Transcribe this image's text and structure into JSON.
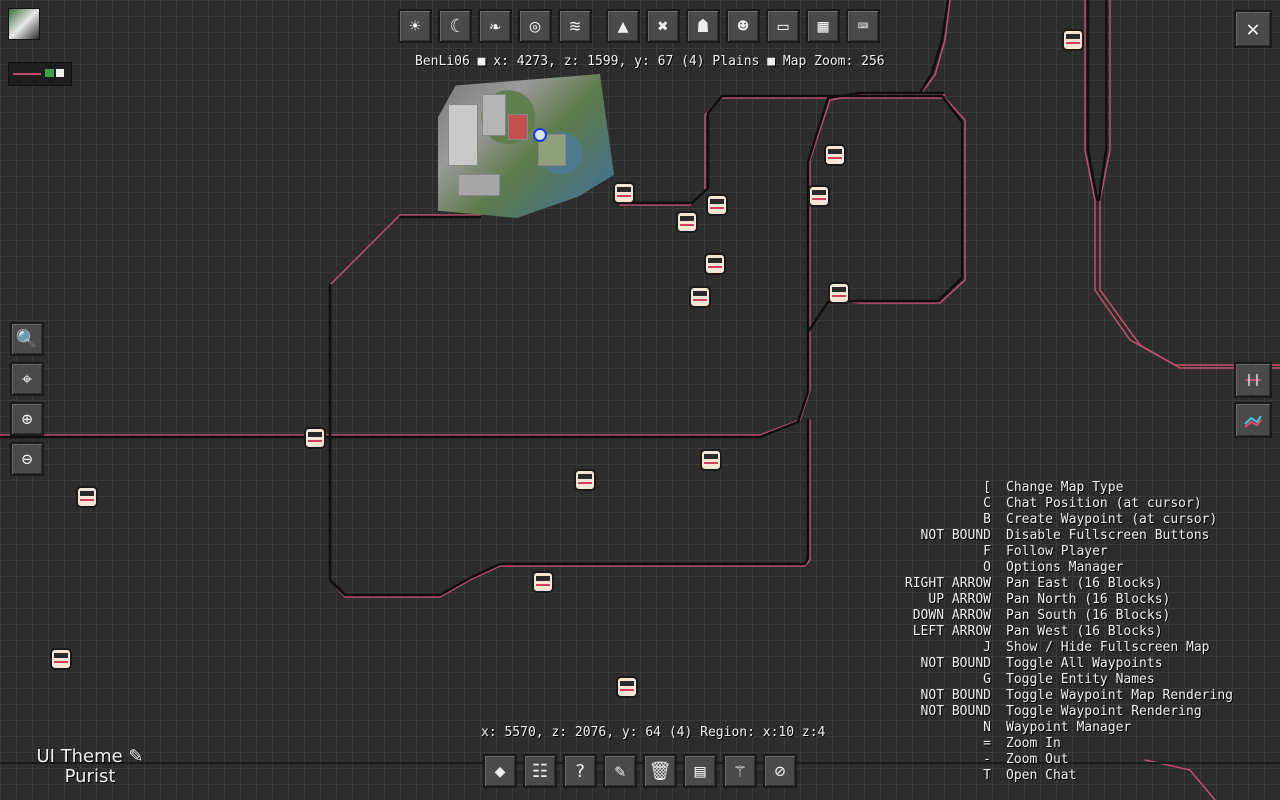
{
  "status": {
    "player_line": "BenLi06 ■ x: 4273, z: 1599, y: 67 (4) Plains ■ Map Zoom: 256",
    "cursor_line": "x: 5570, z: 2076, y: 64 (4)  Region: x:10 z:4"
  },
  "theme": {
    "label": "UI Theme ✎",
    "value": "Purist"
  },
  "top_toolbar": [
    {
      "name": "day-mode-icon",
      "glyph": "☀"
    },
    {
      "name": "night-mode-icon",
      "glyph": "☾"
    },
    {
      "name": "biome-mode-icon",
      "glyph": "❧"
    },
    {
      "name": "topo-mode-icon",
      "glyph": "◎"
    },
    {
      "name": "layers-icon",
      "glyph": "≋"
    },
    {
      "name": "caves-icon",
      "glyph": "▲"
    },
    {
      "name": "mobs-icon",
      "glyph": "✖"
    },
    {
      "name": "villagers-icon",
      "glyph": "☗"
    },
    {
      "name": "pets-icon",
      "glyph": "☻"
    },
    {
      "name": "players-icon",
      "glyph": "▭"
    },
    {
      "name": "grid-icon",
      "glyph": "▦"
    },
    {
      "name": "keyboard-icon",
      "glyph": "⌨"
    }
  ],
  "left_toolbar": [
    {
      "name": "search-icon",
      "glyph": "🔍"
    },
    {
      "name": "center-on-player-icon",
      "glyph": "⌖"
    },
    {
      "name": "zoom-in-icon",
      "glyph": "⊕"
    },
    {
      "name": "zoom-out-icon",
      "glyph": "⊖"
    }
  ],
  "bottom_toolbar": [
    {
      "name": "waypoint-icon",
      "glyph": "◆"
    },
    {
      "name": "options-icon",
      "glyph": "☷"
    },
    {
      "name": "help-icon",
      "glyph": "?"
    },
    {
      "name": "theme-palette-icon",
      "glyph": "✎"
    },
    {
      "name": "delete-icon",
      "glyph": "🗑"
    },
    {
      "name": "save-map-icon",
      "glyph": "▤"
    },
    {
      "name": "wand-icon",
      "glyph": "⚚"
    },
    {
      "name": "disable-icon",
      "glyph": "⊘"
    }
  ],
  "close_glyph": "✕",
  "keybinds": [
    {
      "key": "[",
      "action": "Change Map Type"
    },
    {
      "key": "C",
      "action": "Chat Position (at cursor)"
    },
    {
      "key": "B",
      "action": "Create Waypoint (at cursor)"
    },
    {
      "key": "NOT BOUND",
      "action": "Disable Fullscreen Buttons"
    },
    {
      "key": "F",
      "action": "Follow Player"
    },
    {
      "key": "O",
      "action": "Options Manager"
    },
    {
      "key": "RIGHT ARROW",
      "action": "Pan East (16 Blocks)"
    },
    {
      "key": "UP ARROW",
      "action": "Pan North (16 Blocks)"
    },
    {
      "key": "DOWN ARROW",
      "action": "Pan South (16 Blocks)"
    },
    {
      "key": "LEFT ARROW",
      "action": "Pan West (16 Blocks)"
    },
    {
      "key": "J",
      "action": "Show / Hide Fullscreen Map"
    },
    {
      "key": "NOT BOUND",
      "action": "Toggle All Waypoints"
    },
    {
      "key": "G",
      "action": "Toggle Entity Names"
    },
    {
      "key": "NOT BOUND",
      "action": "Toggle Waypoint Map Rendering"
    },
    {
      "key": "NOT BOUND",
      "action": "Toggle Waypoint Rendering"
    },
    {
      "key": "N",
      "action": "Waypoint Manager"
    },
    {
      "key": "=",
      "action": "Zoom In"
    },
    {
      "key": "-",
      "action": "Zoom Out"
    },
    {
      "key": "T",
      "action": "Open Chat"
    }
  ],
  "colors": {
    "rail_track": "#111111",
    "rail_pink": "#c0506e",
    "grid": "#3a3a3a",
    "background": "#2c2c2c"
  }
}
